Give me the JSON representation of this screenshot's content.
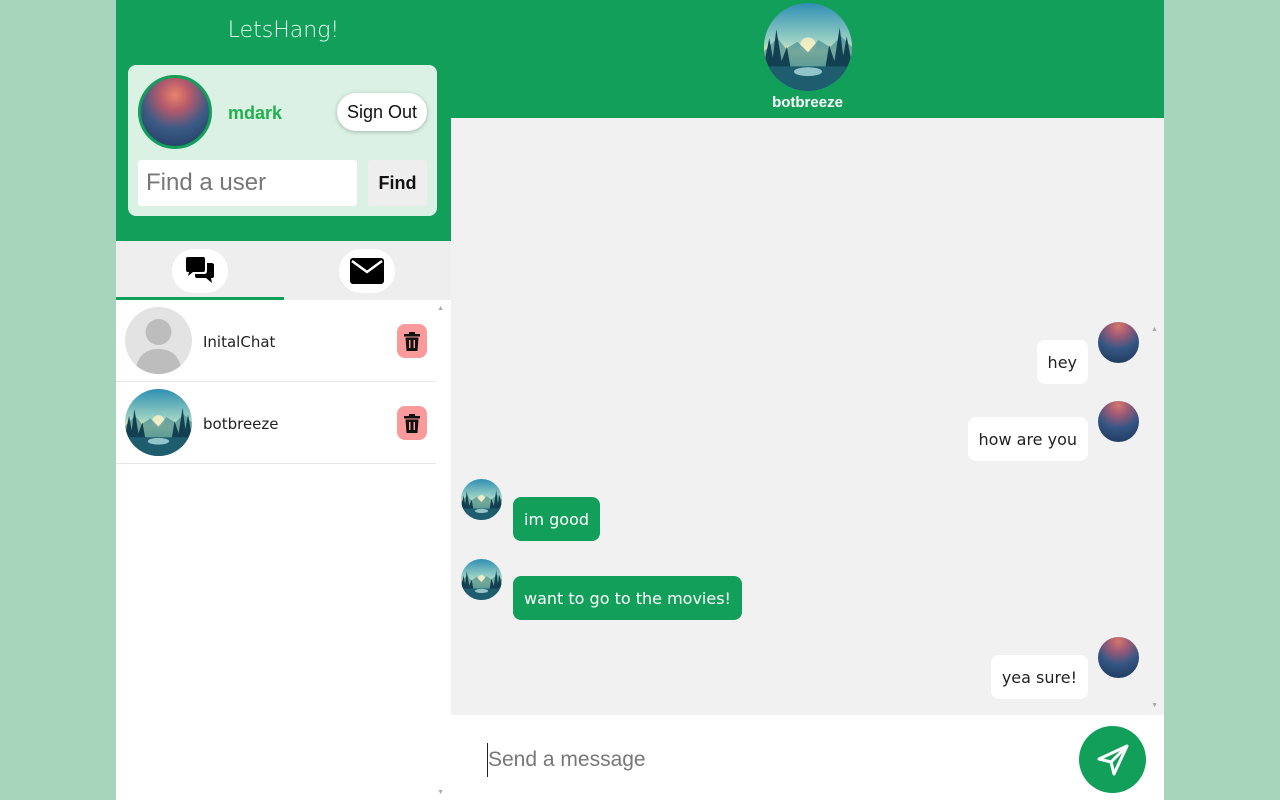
{
  "app": {
    "title": "LetsHang!"
  },
  "user": {
    "username": "mdark",
    "sign_out_label": "Sign Out"
  },
  "search": {
    "placeholder": "Find a user",
    "button_label": "Find"
  },
  "tabs": [
    {
      "name": "chats",
      "icon": "chat-bubbles-icon",
      "active": true
    },
    {
      "name": "messages",
      "icon": "envelope-icon",
      "active": false
    }
  ],
  "chats": [
    {
      "name": "InitalChat",
      "avatar": "default-user-avatar"
    },
    {
      "name": "botbreeze",
      "avatar": "mountain-lake-avatar"
    }
  ],
  "conversation": {
    "contact_name": "botbreeze",
    "messages": [
      {
        "text": "hey",
        "from": "me"
      },
      {
        "text": "how are you",
        "from": "me"
      },
      {
        "text": "im good",
        "from": "them"
      },
      {
        "text": "want to go to the movies!",
        "from": "them"
      },
      {
        "text": "yea sure!",
        "from": "me"
      }
    ]
  },
  "composer": {
    "placeholder": "Send a message"
  },
  "colors": {
    "brand_green": "#129f59",
    "page_bg": "#a7d5bc",
    "delete_bg": "#fb9a9a"
  }
}
